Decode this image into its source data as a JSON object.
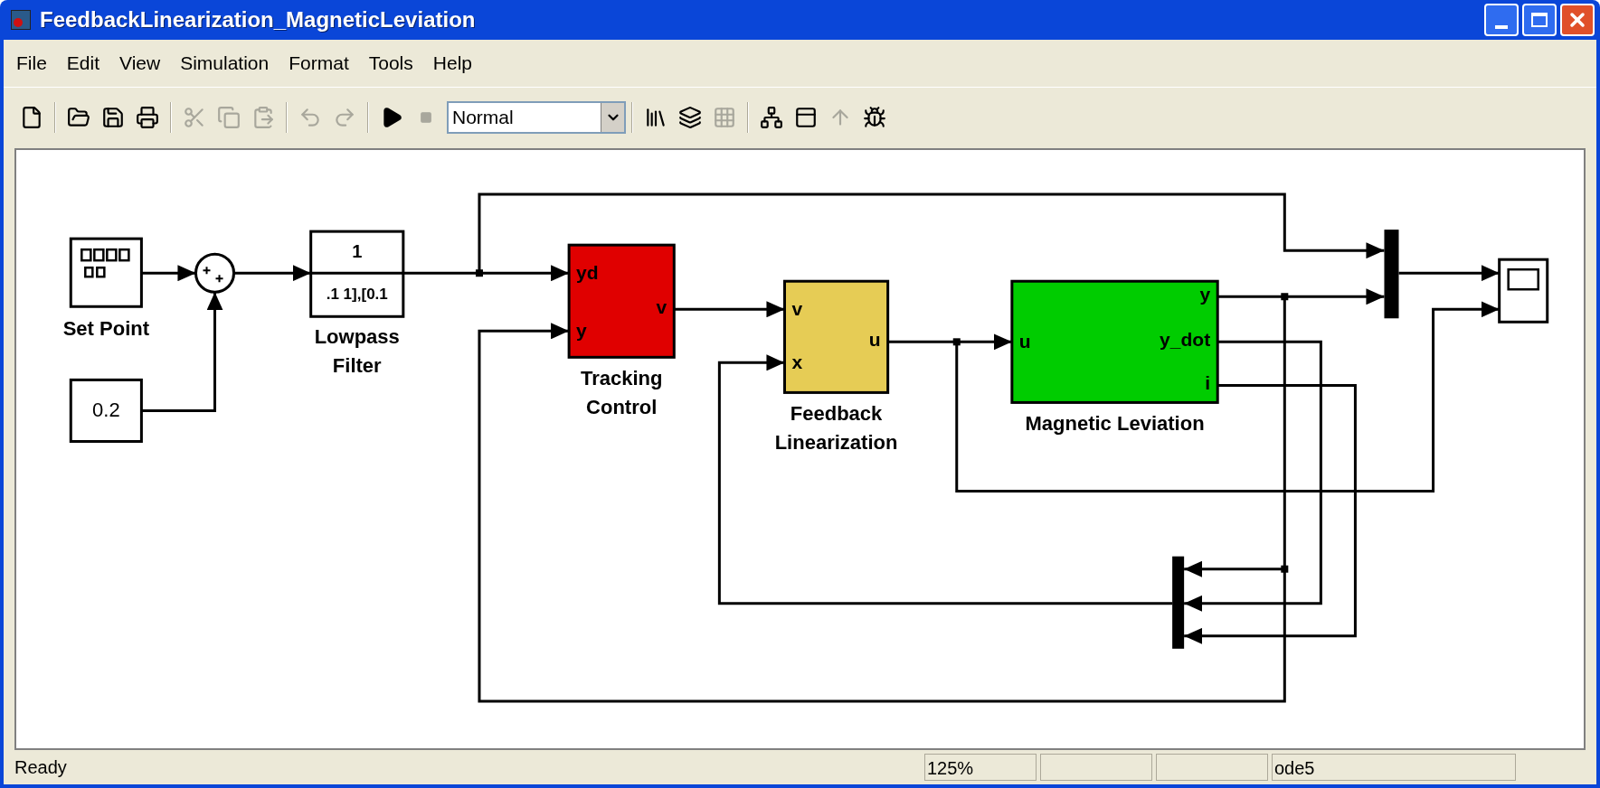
{
  "window": {
    "title": "FeedbackLinearization_MagneticLeviation"
  },
  "menu": [
    {
      "label": "File"
    },
    {
      "label": "Edit"
    },
    {
      "label": "View"
    },
    {
      "label": "Simulation"
    },
    {
      "label": "Format"
    },
    {
      "label": "Tools"
    },
    {
      "label": "Help"
    }
  ],
  "toolbar": {
    "buttons_left": [
      {
        "disabled": false
      },
      {
        "disabled": false
      },
      {
        "disabled": false
      },
      {
        "disabled": false
      },
      {
        "disabled": true
      },
      {
        "disabled": true
      },
      {
        "disabled": true
      },
      {
        "disabled": true
      },
      {
        "disabled": true
      },
      {
        "disabled": false
      },
      {
        "disabled": true
      }
    ],
    "simulation_mode": "Normal",
    "buttons_right": [
      {
        "disabled": false
      },
      {
        "disabled": false
      },
      {
        "disabled": true
      },
      {
        "disabled": false
      },
      {
        "disabled": false
      },
      {
        "disabled": true
      },
      {
        "disabled": false
      }
    ]
  },
  "diagram": {
    "blocks": [
      {
        "kind": "source",
        "label_lines": [
          "Set Point"
        ]
      },
      {
        "kind": "constant",
        "value": "0.2"
      },
      {
        "kind": "sum"
      },
      {
        "kind": "transfer_fcn",
        "numerator": "1",
        "denominator": ".1 1],[0.1",
        "label_lines": [
          "Lowpass",
          "Filter"
        ]
      },
      {
        "kind": "subsystem",
        "label_lines": [
          "Tracking",
          "Control"
        ],
        "color": "#e00000",
        "inputs": [
          "yd",
          "y"
        ],
        "outputs": [
          "v"
        ]
      },
      {
        "kind": "subsystem",
        "label_lines": [
          "Feedback",
          "Linearization"
        ],
        "color": "#e6cc55",
        "inputs": [
          "v",
          "x"
        ],
        "outputs": [
          "u"
        ]
      },
      {
        "kind": "subsystem",
        "label_lines": [
          "Magnetic Leviation"
        ],
        "color": "#00cc00",
        "inputs": [
          "u"
        ],
        "outputs": [
          "y",
          "y_dot",
          "i"
        ]
      },
      {
        "kind": "mux"
      },
      {
        "kind": "scope"
      },
      {
        "kind": "mux"
      }
    ]
  },
  "status_bar": {
    "message": "Ready",
    "zoom": "125%",
    "solver": "ode5"
  }
}
